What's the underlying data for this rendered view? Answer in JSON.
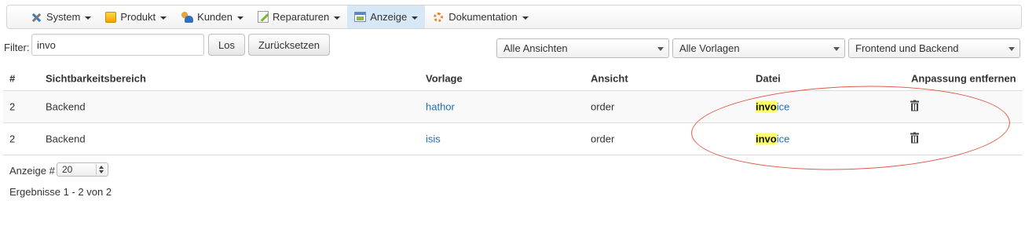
{
  "menu": {
    "items": [
      {
        "label": "System",
        "icon": "tools-icon"
      },
      {
        "label": "Produkt",
        "icon": "product-icon"
      },
      {
        "label": "Kunden",
        "icon": "customers-icon"
      },
      {
        "label": "Reparaturen",
        "icon": "repairs-icon"
      },
      {
        "label": "Anzeige",
        "icon": "display-icon",
        "active": true
      },
      {
        "label": "Dokumentation",
        "icon": "documentation-icon"
      }
    ]
  },
  "filter": {
    "label": "Filter:",
    "value": "invo",
    "search_button": "Los",
    "reset_button": "Zurücksetzen",
    "selects": [
      "Alle Ansichten",
      "Alle Vorlagen",
      "Frontend und Backend"
    ]
  },
  "table": {
    "headers": [
      "#",
      "Sichtbarkeitsbereich",
      "Vorlage",
      "Ansicht",
      "Datei",
      "Anpassung entfernen"
    ],
    "rows": [
      {
        "id": "2",
        "scope": "Backend",
        "template": "hathor",
        "view": "order",
        "file_match": "invo",
        "file_rest": "ice"
      },
      {
        "id": "2",
        "scope": "Backend",
        "template": "isis",
        "view": "order",
        "file_match": "invo",
        "file_rest": "ice"
      }
    ]
  },
  "footer": {
    "display_label": "Anzeige #",
    "page_size": "20",
    "results": "Ergebnisse 1 - 2 von 2"
  },
  "colors": {
    "accent": "#1f6fb5",
    "highlight": "#ffff66",
    "active_menu": "#d6e7f6",
    "annotation": "#e05a4a"
  }
}
